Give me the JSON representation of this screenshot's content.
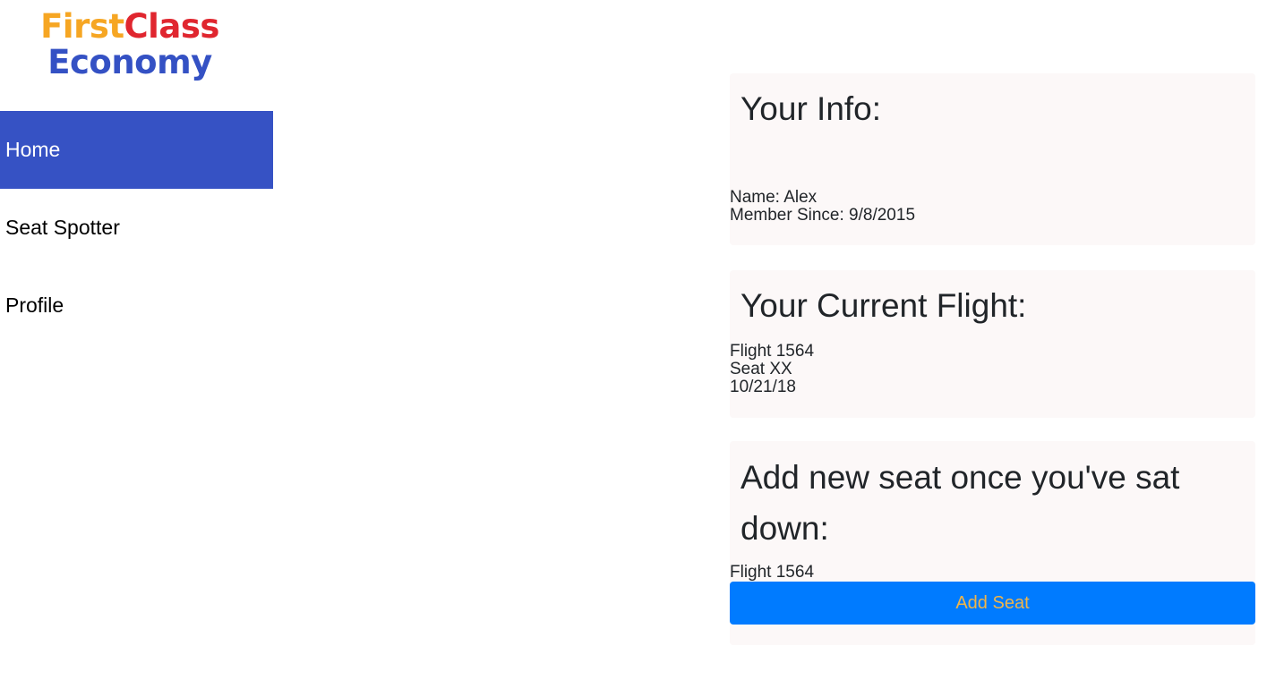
{
  "logo": {
    "first": "First",
    "class": "Class",
    "economy": "Economy"
  },
  "sidebar": {
    "items": [
      {
        "label": "Home",
        "active": true
      },
      {
        "label": "Seat Spotter",
        "active": false
      },
      {
        "label": "Profile",
        "active": false
      }
    ]
  },
  "info_card": {
    "title": "Your Info:",
    "name": "Name: Alex",
    "member_since": "Member Since: 9/8/2015"
  },
  "flight_card": {
    "title": "Your Current Flight:",
    "flight": "Flight 1564",
    "seat": "Seat XX",
    "date": "10/21/18"
  },
  "add_card": {
    "title": "Add new seat once you've sat down:",
    "flight": "Flight 1564",
    "button_label": "Add Seat"
  },
  "colors": {
    "nav_active": "#3652c4",
    "button": "#007bff",
    "button_text": "#f0b54a",
    "card_bg": "#fcf8f8",
    "logo_first": "#f6a623",
    "logo_class": "#e0262f",
    "logo_economy": "#3451c4"
  }
}
